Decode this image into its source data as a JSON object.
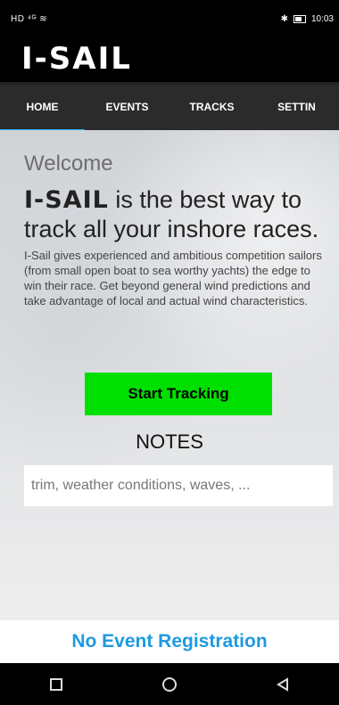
{
  "status_bar": {
    "left_text": "HD ⁴ᴳ ≋",
    "right_text": "10:03"
  },
  "app": {
    "title": "I-SAIL"
  },
  "tabs": [
    {
      "label": "HOME",
      "active": true
    },
    {
      "label": "EVENTS",
      "active": false
    },
    {
      "label": "TRACKS",
      "active": false
    },
    {
      "label": "SETTIN",
      "active": false
    }
  ],
  "home": {
    "welcome": "Welcome",
    "headline_brand": "I-SAIL",
    "headline_rest": " is the best way to track all your inshore races.",
    "description": "I-Sail gives experienced and ambitious competition sailors (from small open boat to sea worthy yachts) the edge to win their race. Get beyond general wind predictions and take advantage of local and actual wind characteristics.",
    "start_button": "Start Tracking",
    "notes_title": "NOTES",
    "notes_placeholder": "trim, weather conditions, waves, ..."
  },
  "registration": {
    "text": "No Event Registration"
  },
  "colors": {
    "accent": "#29b6f6",
    "start_button": "#00e000",
    "registration_text": "#1e9ae0"
  },
  "nav_icons": [
    "square-icon",
    "circle-icon",
    "triangle-back-icon"
  ]
}
